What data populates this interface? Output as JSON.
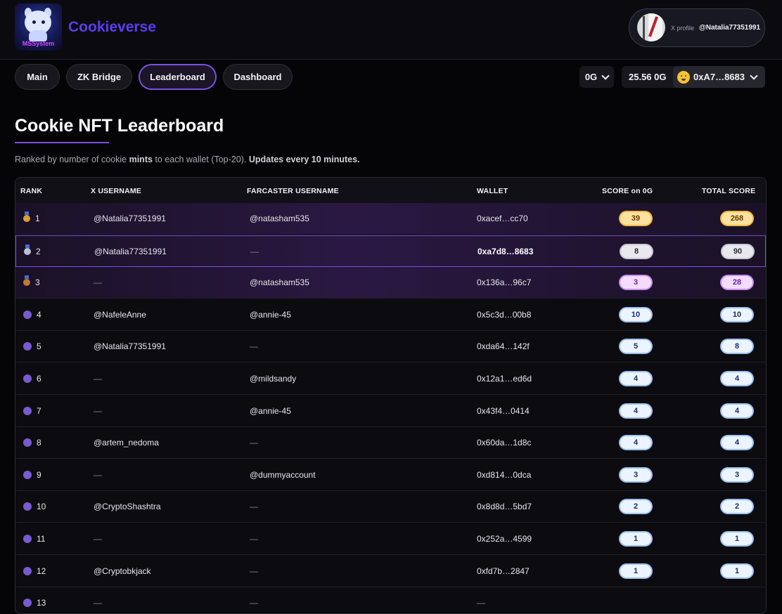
{
  "header": {
    "logo_text": "MSSystem",
    "brand": "Cookieverse",
    "profile_label": "X profile",
    "profile_handle": "@Natalia77351991"
  },
  "nav": {
    "main": "Main",
    "zk_bridge": "ZK Bridge",
    "leaderboard": "Leaderboard",
    "dashboard": "Dashboard",
    "active": "Leaderboard"
  },
  "wallet": {
    "chain": "0G",
    "balance": "25.56 0G",
    "address": "0xA7…8683"
  },
  "page": {
    "title": "Cookie NFT Leaderboard",
    "subtitle_a": "Ranked by number of cookie ",
    "subtitle_b": "mints",
    "subtitle_c": " to each wallet (Top-20). ",
    "subtitle_d": "Updates every 10 minutes."
  },
  "table": {
    "headers": {
      "rank": "RANK",
      "x": "X USERNAME",
      "farcaster": "FARCASTER USERNAME",
      "wallet": "WALLET",
      "score0g": "SCORE on 0G",
      "total": "TOTAL SCORE"
    },
    "rows": [
      {
        "rank": "1",
        "x": "@Natalia77351991",
        "farcaster": "@natasham535",
        "wallet": "0xacef…cc70",
        "score": "39",
        "total": "268"
      },
      {
        "rank": "2",
        "x": "@Natalia77351991",
        "farcaster": "—",
        "wallet": "0xa7d8…8683",
        "score": "8",
        "total": "90"
      },
      {
        "rank": "3",
        "x": "—",
        "farcaster": "@natasham535",
        "wallet": "0x136a…96c7",
        "score": "3",
        "total": "28"
      },
      {
        "rank": "4",
        "x": "@NafeleAnne",
        "farcaster": "@annie-45",
        "wallet": "0x5c3d…00b8",
        "score": "10",
        "total": "10"
      },
      {
        "rank": "5",
        "x": "@Natalia77351991",
        "farcaster": "—",
        "wallet": "0xda64…142f",
        "score": "5",
        "total": "8"
      },
      {
        "rank": "6",
        "x": "—",
        "farcaster": "@mildsandy",
        "wallet": "0x12a1…ed6d",
        "score": "4",
        "total": "4"
      },
      {
        "rank": "7",
        "x": "—",
        "farcaster": "@annie-45",
        "wallet": "0x43f4…0414",
        "score": "4",
        "total": "4"
      },
      {
        "rank": "8",
        "x": "@artem_nedoma",
        "farcaster": "—",
        "wallet": "0x60da…1d8c",
        "score": "4",
        "total": "4"
      },
      {
        "rank": "9",
        "x": "—",
        "farcaster": "@dummyaccount",
        "wallet": "0xd814…0dca",
        "score": "3",
        "total": "3"
      },
      {
        "rank": "10",
        "x": "@CryptoShashtra",
        "farcaster": "—",
        "wallet": "0x8d8d…5bd7",
        "score": "2",
        "total": "2"
      },
      {
        "rank": "11",
        "x": "—",
        "farcaster": "—",
        "wallet": "0x252a…4599",
        "score": "1",
        "total": "1"
      },
      {
        "rank": "12",
        "x": "@Cryptobkjack",
        "farcaster": "—",
        "wallet": "0xfd7b…2847",
        "score": "1",
        "total": "1"
      },
      {
        "rank": "13",
        "x": "—",
        "farcaster": "—",
        "wallet": "—",
        "score": "",
        "total": ""
      }
    ]
  },
  "colors": {
    "accent": "#7a4fe0",
    "brand": "#5a3df0",
    "gold": "#f0b840",
    "silver": "#c8c8d2",
    "bronze": "#c98cf0",
    "blue": "#9cc0f0"
  }
}
